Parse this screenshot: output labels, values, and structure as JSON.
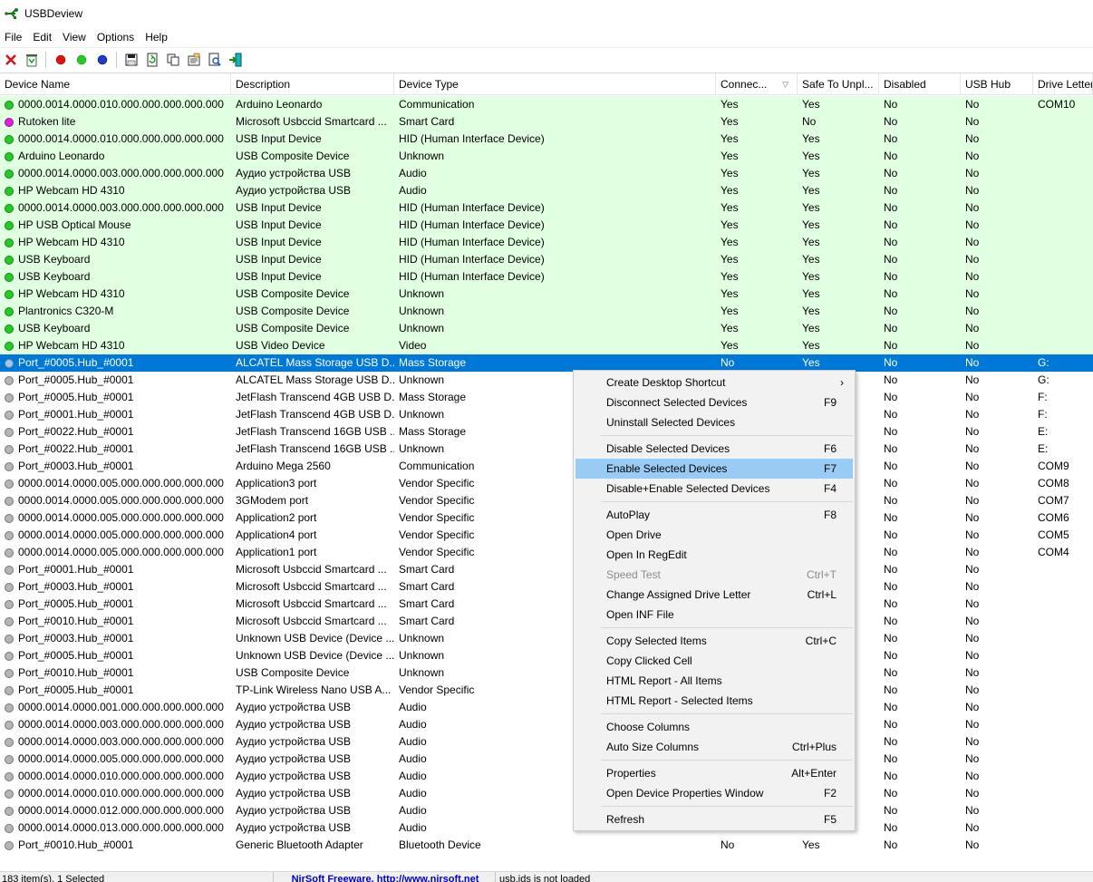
{
  "window": {
    "title": "USBDeview"
  },
  "menu": [
    "File",
    "Edit",
    "View",
    "Options",
    "Help"
  ],
  "colors": {
    "connected_row": "#e1ffe1",
    "selected_row": "#0078d7",
    "menu_highlight": "#99ccf5"
  },
  "icons": {
    "toolbar": [
      "delete-icon",
      "recycle-icon",
      "red-dot-icon",
      "green-dot-icon",
      "blue-dot-icon",
      "save-icon",
      "refresh-icon",
      "copy-icon",
      "properties-icon",
      "find-icon",
      "exit-icon"
    ]
  },
  "columns": [
    "Device Name",
    "Description",
    "Device Type",
    "Connec...",
    "Safe To Unpl...",
    "Disabled",
    "USB Hub",
    "Drive Letter"
  ],
  "rows": [
    {
      "status": "green",
      "name": "0000.0014.0000.010.000.000.000.000.000",
      "desc": "Arduino Leonardo",
      "type": "Communication",
      "connected": "Yes",
      "safe": "Yes",
      "disabled": "No",
      "hub": "No",
      "drive": "COM10",
      "conn": true
    },
    {
      "status": "magenta",
      "name": "Rutoken lite",
      "desc": "Microsoft Usbccid Smartcard ...",
      "type": "Smart Card",
      "connected": "Yes",
      "safe": "No",
      "disabled": "No",
      "hub": "No",
      "drive": "",
      "conn": true
    },
    {
      "status": "green",
      "name": "0000.0014.0000.010.000.000.000.000.000",
      "desc": "USB Input Device",
      "type": "HID (Human Interface Device)",
      "connected": "Yes",
      "safe": "Yes",
      "disabled": "No",
      "hub": "No",
      "drive": "",
      "conn": true
    },
    {
      "status": "green",
      "name": "Arduino Leonardo",
      "desc": "USB Composite Device",
      "type": "Unknown",
      "connected": "Yes",
      "safe": "Yes",
      "disabled": "No",
      "hub": "No",
      "drive": "",
      "conn": true
    },
    {
      "status": "green",
      "name": "0000.0014.0000.003.000.000.000.000.000",
      "desc": "Аудио устройства USB",
      "type": "Audio",
      "connected": "Yes",
      "safe": "Yes",
      "disabled": "No",
      "hub": "No",
      "drive": "",
      "conn": true
    },
    {
      "status": "green",
      "name": "HP Webcam HD 4310",
      "desc": "Аудио устройства USB",
      "type": "Audio",
      "connected": "Yes",
      "safe": "Yes",
      "disabled": "No",
      "hub": "No",
      "drive": "",
      "conn": true
    },
    {
      "status": "green",
      "name": "0000.0014.0000.003.000.000.000.000.000",
      "desc": "USB Input Device",
      "type": "HID (Human Interface Device)",
      "connected": "Yes",
      "safe": "Yes",
      "disabled": "No",
      "hub": "No",
      "drive": "",
      "conn": true
    },
    {
      "status": "green",
      "name": "HP USB Optical Mouse",
      "desc": "USB Input Device",
      "type": "HID (Human Interface Device)",
      "connected": "Yes",
      "safe": "Yes",
      "disabled": "No",
      "hub": "No",
      "drive": "",
      "conn": true
    },
    {
      "status": "green",
      "name": "HP Webcam HD 4310",
      "desc": "USB Input Device",
      "type": "HID (Human Interface Device)",
      "connected": "Yes",
      "safe": "Yes",
      "disabled": "No",
      "hub": "No",
      "drive": "",
      "conn": true
    },
    {
      "status": "green",
      "name": "USB Keyboard",
      "desc": "USB Input Device",
      "type": "HID (Human Interface Device)",
      "connected": "Yes",
      "safe": "Yes",
      "disabled": "No",
      "hub": "No",
      "drive": "",
      "conn": true
    },
    {
      "status": "green",
      "name": "USB Keyboard",
      "desc": "USB Input Device",
      "type": "HID (Human Interface Device)",
      "connected": "Yes",
      "safe": "Yes",
      "disabled": "No",
      "hub": "No",
      "drive": "",
      "conn": true
    },
    {
      "status": "green",
      "name": "HP Webcam HD 4310",
      "desc": "USB Composite Device",
      "type": "Unknown",
      "connected": "Yes",
      "safe": "Yes",
      "disabled": "No",
      "hub": "No",
      "drive": "",
      "conn": true
    },
    {
      "status": "green",
      "name": "Plantronics C320-M",
      "desc": "USB Composite Device",
      "type": "Unknown",
      "connected": "Yes",
      "safe": "Yes",
      "disabled": "No",
      "hub": "No",
      "drive": "",
      "conn": true
    },
    {
      "status": "green",
      "name": "USB Keyboard",
      "desc": "USB Composite Device",
      "type": "Unknown",
      "connected": "Yes",
      "safe": "Yes",
      "disabled": "No",
      "hub": "No",
      "drive": "",
      "conn": true
    },
    {
      "status": "green",
      "name": "HP Webcam HD 4310",
      "desc": "USB Video Device",
      "type": "Video",
      "connected": "Yes",
      "safe": "Yes",
      "disabled": "No",
      "hub": "No",
      "drive": "",
      "conn": true
    },
    {
      "status": "blue",
      "name": "Port_#0005.Hub_#0001",
      "desc": "ALCATEL Mass Storage USB D...",
      "type": "Mass Storage",
      "connected": "No",
      "safe": "Yes",
      "disabled": "No",
      "hub": "No",
      "drive": "G:",
      "sel": true
    },
    {
      "status": "gray",
      "name": "Port_#0005.Hub_#0001",
      "desc": "ALCATEL Mass Storage USB D...",
      "type": "Unknown",
      "connected": "",
      "safe": "",
      "disabled": "No",
      "hub": "No",
      "drive": "G:"
    },
    {
      "status": "gray",
      "name": "Port_#0005.Hub_#0001",
      "desc": "JetFlash Transcend 4GB USB D...",
      "type": "Mass Storage",
      "connected": "",
      "safe": "",
      "disabled": "No",
      "hub": "No",
      "drive": "F:"
    },
    {
      "status": "gray",
      "name": "Port_#0001.Hub_#0001",
      "desc": "JetFlash Transcend 4GB USB D...",
      "type": "Unknown",
      "connected": "",
      "safe": "",
      "disabled": "No",
      "hub": "No",
      "drive": "F:"
    },
    {
      "status": "gray",
      "name": "Port_#0022.Hub_#0001",
      "desc": "JetFlash Transcend 16GB USB ...",
      "type": "Mass Storage",
      "connected": "",
      "safe": "",
      "disabled": "No",
      "hub": "No",
      "drive": "E:"
    },
    {
      "status": "gray",
      "name": "Port_#0022.Hub_#0001",
      "desc": "JetFlash Transcend 16GB USB ...",
      "type": "Unknown",
      "connected": "",
      "safe": "",
      "disabled": "No",
      "hub": "No",
      "drive": "E:"
    },
    {
      "status": "gray",
      "name": "Port_#0003.Hub_#0001",
      "desc": "Arduino Mega 2560",
      "type": "Communication",
      "connected": "",
      "safe": "",
      "disabled": "No",
      "hub": "No",
      "drive": "COM9"
    },
    {
      "status": "gray",
      "name": "0000.0014.0000.005.000.000.000.000.000",
      "desc": "Application3 port",
      "type": "Vendor Specific",
      "connected": "",
      "safe": "",
      "disabled": "No",
      "hub": "No",
      "drive": "COM8"
    },
    {
      "status": "gray",
      "name": "0000.0014.0000.005.000.000.000.000.000",
      "desc": "3GModem port",
      "type": "Vendor Specific",
      "connected": "",
      "safe": "",
      "disabled": "No",
      "hub": "No",
      "drive": "COM7"
    },
    {
      "status": "gray",
      "name": "0000.0014.0000.005.000.000.000.000.000",
      "desc": "Application2 port",
      "type": "Vendor Specific",
      "connected": "",
      "safe": "",
      "disabled": "No",
      "hub": "No",
      "drive": "COM6"
    },
    {
      "status": "gray",
      "name": "0000.0014.0000.005.000.000.000.000.000",
      "desc": "Application4 port",
      "type": "Vendor Specific",
      "connected": "",
      "safe": "",
      "disabled": "No",
      "hub": "No",
      "drive": "COM5"
    },
    {
      "status": "gray",
      "name": "0000.0014.0000.005.000.000.000.000.000",
      "desc": "Application1 port",
      "type": "Vendor Specific",
      "connected": "",
      "safe": "",
      "disabled": "No",
      "hub": "No",
      "drive": "COM4"
    },
    {
      "status": "gray",
      "name": "Port_#0001.Hub_#0001",
      "desc": "Microsoft Usbccid Smartcard ...",
      "type": "Smart Card",
      "connected": "",
      "safe": "",
      "disabled": "No",
      "hub": "No",
      "drive": ""
    },
    {
      "status": "gray",
      "name": "Port_#0003.Hub_#0001",
      "desc": "Microsoft Usbccid Smartcard ...",
      "type": "Smart Card",
      "connected": "",
      "safe": "",
      "disabled": "No",
      "hub": "No",
      "drive": ""
    },
    {
      "status": "gray",
      "name": "Port_#0005.Hub_#0001",
      "desc": "Microsoft Usbccid Smartcard ...",
      "type": "Smart Card",
      "connected": "",
      "safe": "",
      "disabled": "No",
      "hub": "No",
      "drive": ""
    },
    {
      "status": "gray",
      "name": "Port_#0010.Hub_#0001",
      "desc": "Microsoft Usbccid Smartcard ...",
      "type": "Smart Card",
      "connected": "",
      "safe": "",
      "disabled": "No",
      "hub": "No",
      "drive": ""
    },
    {
      "status": "gray",
      "name": "Port_#0003.Hub_#0001",
      "desc": "Unknown USB Device (Device ...",
      "type": "Unknown",
      "connected": "",
      "safe": "",
      "disabled": "No",
      "hub": "No",
      "drive": ""
    },
    {
      "status": "gray",
      "name": "Port_#0005.Hub_#0001",
      "desc": "Unknown USB Device (Device ...",
      "type": "Unknown",
      "connected": "",
      "safe": "",
      "disabled": "No",
      "hub": "No",
      "drive": ""
    },
    {
      "status": "gray",
      "name": "Port_#0010.Hub_#0001",
      "desc": "USB Composite Device",
      "type": "Unknown",
      "connected": "",
      "safe": "",
      "disabled": "No",
      "hub": "No",
      "drive": ""
    },
    {
      "status": "gray",
      "name": "Port_#0005.Hub_#0001",
      "desc": "TP-Link Wireless Nano USB A...",
      "type": "Vendor Specific",
      "connected": "",
      "safe": "",
      "disabled": "No",
      "hub": "No",
      "drive": ""
    },
    {
      "status": "gray",
      "name": "0000.0014.0000.001.000.000.000.000.000",
      "desc": "Аудио устройства USB",
      "type": "Audio",
      "connected": "",
      "safe": "",
      "disabled": "No",
      "hub": "No",
      "drive": ""
    },
    {
      "status": "gray",
      "name": "0000.0014.0000.003.000.000.000.000.000",
      "desc": "Аудио устройства USB",
      "type": "Audio",
      "connected": "",
      "safe": "",
      "disabled": "No",
      "hub": "No",
      "drive": ""
    },
    {
      "status": "gray",
      "name": "0000.0014.0000.003.000.000.000.000.000",
      "desc": "Аудио устройства USB",
      "type": "Audio",
      "connected": "",
      "safe": "",
      "disabled": "No",
      "hub": "No",
      "drive": ""
    },
    {
      "status": "gray",
      "name": "0000.0014.0000.005.000.000.000.000.000",
      "desc": "Аудио устройства USB",
      "type": "Audio",
      "connected": "",
      "safe": "",
      "disabled": "No",
      "hub": "No",
      "drive": ""
    },
    {
      "status": "gray",
      "name": "0000.0014.0000.010.000.000.000.000.000",
      "desc": "Аудио устройства USB",
      "type": "Audio",
      "connected": "",
      "safe": "",
      "disabled": "No",
      "hub": "No",
      "drive": ""
    },
    {
      "status": "gray",
      "name": "0000.0014.0000.010.000.000.000.000.000",
      "desc": "Аудио устройства USB",
      "type": "Audio",
      "connected": "",
      "safe": "",
      "disabled": "No",
      "hub": "No",
      "drive": ""
    },
    {
      "status": "gray",
      "name": "0000.0014.0000.012.000.000.000.000.000",
      "desc": "Аудио устройства USB",
      "type": "Audio",
      "connected": "",
      "safe": "",
      "disabled": "No",
      "hub": "No",
      "drive": ""
    },
    {
      "status": "gray",
      "name": "0000.0014.0000.013.000.000.000.000.000",
      "desc": "Аудио устройства USB",
      "type": "Audio",
      "connected": "",
      "safe": "",
      "disabled": "No",
      "hub": "No",
      "drive": ""
    },
    {
      "status": "gray",
      "name": "Port_#0010.Hub_#0001",
      "desc": "Generic Bluetooth Adapter",
      "type": "Bluetooth Device",
      "connected": "No",
      "safe": "Yes",
      "disabled": "No",
      "hub": "No",
      "drive": ""
    }
  ],
  "context_menu": [
    {
      "label": "Create Desktop Shortcut",
      "shortcut": "",
      "submenu": true
    },
    {
      "label": "Disconnect Selected Devices",
      "shortcut": "F9"
    },
    {
      "label": "Uninstall Selected Devices",
      "shortcut": ""
    },
    {
      "sep": true
    },
    {
      "label": "Disable Selected Devices",
      "shortcut": "F6"
    },
    {
      "label": "Enable Selected Devices",
      "shortcut": "F7",
      "active": true
    },
    {
      "label": "Disable+Enable Selected Devices",
      "shortcut": "F4"
    },
    {
      "sep": true
    },
    {
      "label": "AutoPlay",
      "shortcut": "F8"
    },
    {
      "label": "Open Drive",
      "shortcut": ""
    },
    {
      "label": "Open In RegEdit",
      "shortcut": ""
    },
    {
      "label": "Speed Test",
      "shortcut": "Ctrl+T",
      "disabled": true
    },
    {
      "label": "Change Assigned Drive Letter",
      "shortcut": "Ctrl+L"
    },
    {
      "label": "Open INF File",
      "shortcut": ""
    },
    {
      "sep": true
    },
    {
      "label": "Copy Selected Items",
      "shortcut": "Ctrl+C"
    },
    {
      "label": "Copy Clicked Cell",
      "shortcut": ""
    },
    {
      "label": "HTML Report - All Items",
      "shortcut": ""
    },
    {
      "label": "HTML Report - Selected Items",
      "shortcut": ""
    },
    {
      "sep": true
    },
    {
      "label": "Choose Columns",
      "shortcut": ""
    },
    {
      "label": "Auto Size Columns",
      "shortcut": "Ctrl+Plus"
    },
    {
      "sep": true
    },
    {
      "label": "Properties",
      "shortcut": "Alt+Enter"
    },
    {
      "label": "Open Device Properties Window",
      "shortcut": "F2"
    },
    {
      "sep": true
    },
    {
      "label": "Refresh",
      "shortcut": "F5"
    }
  ],
  "status": {
    "count": "183 item(s), 1 Selected",
    "link": "NirSoft Freeware.  http://www.nirsoft.net",
    "usbids": "usb.ids is not loaded"
  }
}
